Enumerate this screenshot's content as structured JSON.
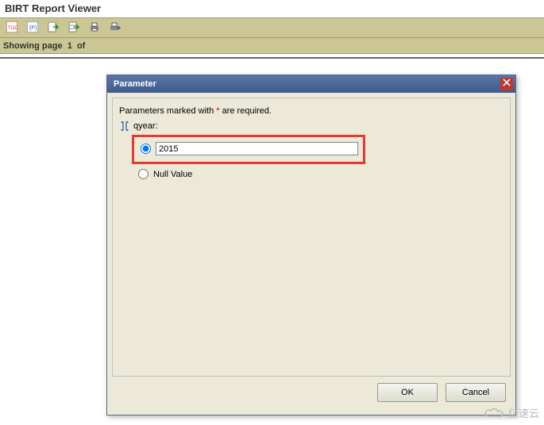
{
  "app": {
    "title": "BIRT Report Viewer"
  },
  "toolbar": {
    "items": [
      {
        "name": "toc-icon"
      },
      {
        "name": "parameters-icon"
      },
      {
        "name": "export-report-icon"
      },
      {
        "name": "export-data-icon"
      },
      {
        "name": "print-icon"
      },
      {
        "name": "print-server-icon"
      }
    ]
  },
  "status": {
    "showing_prefix": "Showing page",
    "page_number": "1",
    "of_text": "of"
  },
  "dialog": {
    "title": "Parameter",
    "required_prefix": "Parameters marked with ",
    "required_mark": "*",
    "required_suffix": " are required.",
    "param_label": "qyear:",
    "input_value": "2015",
    "null_label": "Null Value",
    "ok_label": "OK",
    "cancel_label": "Cancel"
  },
  "watermark": {
    "text": "亿速云"
  }
}
